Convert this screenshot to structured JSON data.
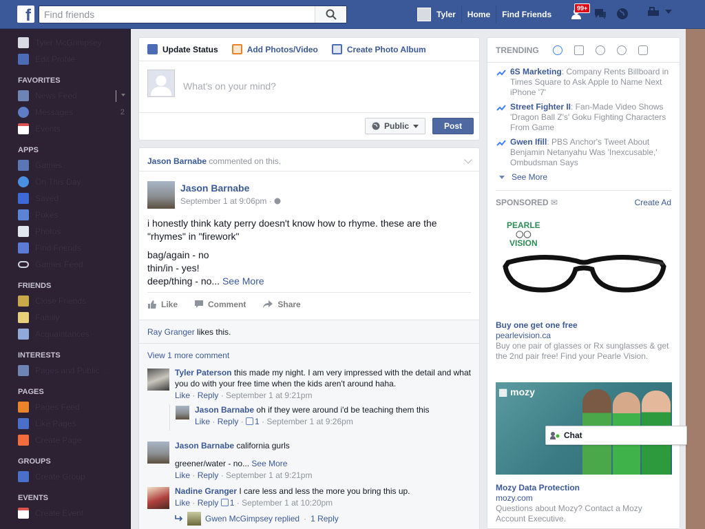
{
  "topbar": {
    "search_placeholder": "Find friends",
    "user_name": "Tyler",
    "home": "Home",
    "find_friends": "Find Friends",
    "friend_requests_badge": "99+"
  },
  "sidebar": {
    "profile_name": "Tyler McGrimpsey",
    "edit_profile": "Edit Profile",
    "sections": {
      "favorites": "FAVORITES",
      "apps": "APPS",
      "friends": "FRIENDS",
      "interests": "INTERESTS",
      "pages": "PAGES",
      "groups": "GROUPS",
      "events": "EVENTS"
    },
    "favorites": [
      {
        "label": "News Feed"
      },
      {
        "label": "Messages",
        "count": "2"
      },
      {
        "label": "Events"
      }
    ],
    "apps": [
      {
        "label": "Games"
      },
      {
        "label": "On This Day"
      },
      {
        "label": "Saved"
      },
      {
        "label": "Pokes"
      },
      {
        "label": "Photos"
      },
      {
        "label": "Find Friends"
      },
      {
        "label": "Games Feed"
      }
    ],
    "friends": [
      {
        "label": "Close Friends"
      },
      {
        "label": "Family"
      },
      {
        "label": "Acquaintances"
      }
    ],
    "interests": [
      {
        "label": "Pages and Public Figures"
      }
    ],
    "pages": [
      {
        "label": "Pages Feed"
      },
      {
        "label": "Like Pages"
      },
      {
        "label": "Create Page"
      }
    ],
    "groups": [
      {
        "label": "Create Group"
      }
    ],
    "events": [
      {
        "label": "Create Event"
      }
    ]
  },
  "composer": {
    "tab_update": "Update Status",
    "tab_photos": "Add Photos/Video",
    "tab_album": "Create Photo Album",
    "placeholder": "What's on your mind?",
    "privacy": "Public",
    "post": "Post"
  },
  "story": {
    "header_name": "Jason Barnabe",
    "header_action": "commented on this.",
    "author": "Jason Barnabe",
    "time": "September 1 at 9:06pm",
    "text_line1": "i honestly think katy perry doesn't know how to rhyme. these are the \"rhymes\" in \"firework\"",
    "text_line2": "bag/again - no",
    "text_line3": "thin/in - yes!",
    "text_line4": "deep/thing - no...",
    "see_more": "See More",
    "like": "Like",
    "comment": "Comment",
    "share": "Share",
    "likes_name": "Ray Granger",
    "likes_suffix": "likes this.",
    "view_more": "View 1 more comment",
    "like_label": "Like",
    "reply_label": "Reply",
    "comments": [
      {
        "name": "Tyler Paterson",
        "text": "this made my night. I am very impressed with the detail and what you do with your free time when the kids aren't around haha.",
        "time": "September 1 at 9:21pm"
      },
      {
        "name": "Jason Barnabe",
        "text": "california gurls",
        "text2": "greener/water - no...",
        "see_more": "See More",
        "time": "September 1 at 9:21pm"
      },
      {
        "name": "Nadine Granger",
        "text": "I care less and less the more you bring this up.",
        "likes": "1",
        "time": "September 1 at 10:20pm"
      }
    ],
    "reply1": {
      "name": "Jason Barnabe",
      "text": "oh if they were around i'd be teaching them this",
      "likes": "1",
      "time": "September 1 at 9:26pm"
    },
    "replied_summary": {
      "name": "Gwen McGimpsey",
      "action": "replied",
      "count": "1 Reply"
    }
  },
  "trending": {
    "title": "TRENDING",
    "items": [
      {
        "topic": "6S Marketing",
        "desc": ": Company Rents Billboard in Times Square to Ask Apple to Name Next iPhone '7'"
      },
      {
        "topic": "Street Fighter II",
        "desc": ": Fan-Made Video Shows 'Dragon Ball Z's' Goku Fighting Characters From Game"
      },
      {
        "topic": "Gwen Ifill",
        "desc": ": PBS Anchor's Tweet About Benjamin Netanyahu Was 'Inexcusable,' Ombudsman Says"
      }
    ],
    "see_more": "See More"
  },
  "sponsored": {
    "title": "SPONSORED",
    "create_ad": "Create Ad",
    "ad1": {
      "brand_line1": "PEARLE",
      "brand_line2": "VISION",
      "title": "Buy one get one free",
      "url": "pearlevision.ca",
      "desc": "Buy one pair of glasses or Rx sunglasses & get the 2nd pair free! Find your Pearle Vision."
    },
    "ad2": {
      "brand": "mozy",
      "title": "Mozy Data Protection",
      "url": "mozy.com",
      "desc": "Questions about Mozy? Contact a Mozy Account Executive."
    }
  },
  "chat": {
    "label": "Chat"
  },
  "colors": {
    "brand": "#3b5998",
    "sidebar_bg": "#2c2234",
    "badge": "#dc0d17"
  }
}
